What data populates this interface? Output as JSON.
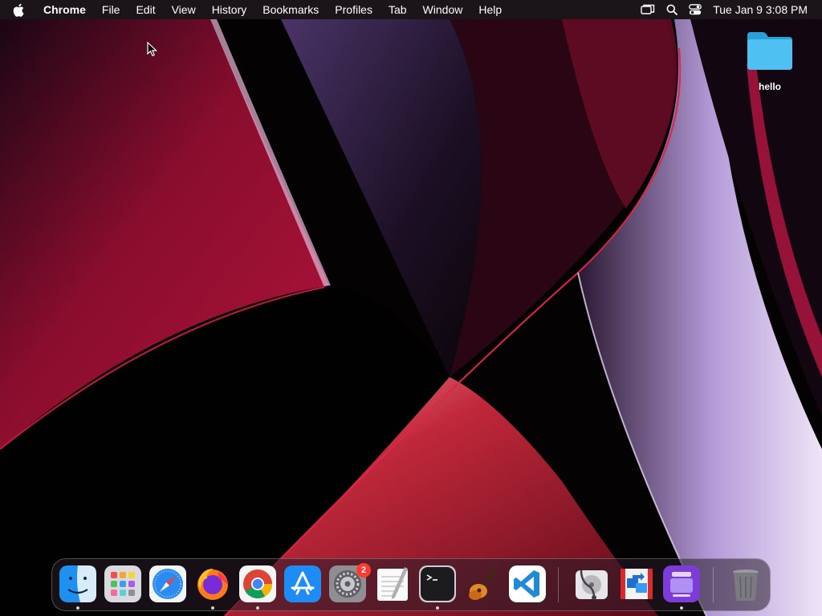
{
  "menubar": {
    "app_name": "Chrome",
    "items": [
      "File",
      "Edit",
      "View",
      "History",
      "Bookmarks",
      "Profiles",
      "Tab",
      "Window",
      "Help"
    ],
    "status_icons": [
      "screen-mirroring-icon",
      "spotlight-search-icon",
      "control-center-icon"
    ],
    "clock": "Tue Jan 9  3:08 PM"
  },
  "desktop": {
    "folder": {
      "label": "hello",
      "icon": "folder-icon",
      "color": "#3fb6f0"
    }
  },
  "dock": {
    "apps": [
      {
        "name": "Finder",
        "icon": "finder-icon",
        "running": true
      },
      {
        "name": "Launchpad",
        "icon": "launchpad-icon",
        "running": false
      },
      {
        "name": "Safari",
        "icon": "safari-icon",
        "running": false
      },
      {
        "name": "Firefox",
        "icon": "firefox-icon",
        "running": true
      },
      {
        "name": "Google Chrome",
        "icon": "chrome-icon",
        "running": true
      },
      {
        "name": "App Store",
        "icon": "app-store-icon",
        "running": false
      },
      {
        "name": "System Settings",
        "icon": "system-settings-icon",
        "running": false,
        "badge": "2"
      },
      {
        "name": "TextEdit",
        "icon": "textedit-icon",
        "running": false
      },
      {
        "name": "Terminal",
        "icon": "terminal-icon",
        "running": true
      },
      {
        "name": "GarageBand",
        "icon": "garageband-icon",
        "running": false
      },
      {
        "name": "Visual Studio Code",
        "icon": "vscode-icon",
        "running": false
      },
      {
        "name": "Disk Utility",
        "icon": "disk-utility-icon",
        "running": false
      },
      {
        "name": "Migration Assistant",
        "icon": "migration-assistant-icon",
        "running": false
      },
      {
        "name": "Simulator",
        "icon": "simulator-icon",
        "running": true
      },
      {
        "name": "Trash",
        "icon": "trash-icon",
        "running": false
      }
    ]
  },
  "colors": {
    "menubar_bg": "#1b1418",
    "wallpaper_red": "#9b0f33",
    "wallpaper_lavender": "#c8b4e6",
    "badge": "#ff3b30"
  }
}
